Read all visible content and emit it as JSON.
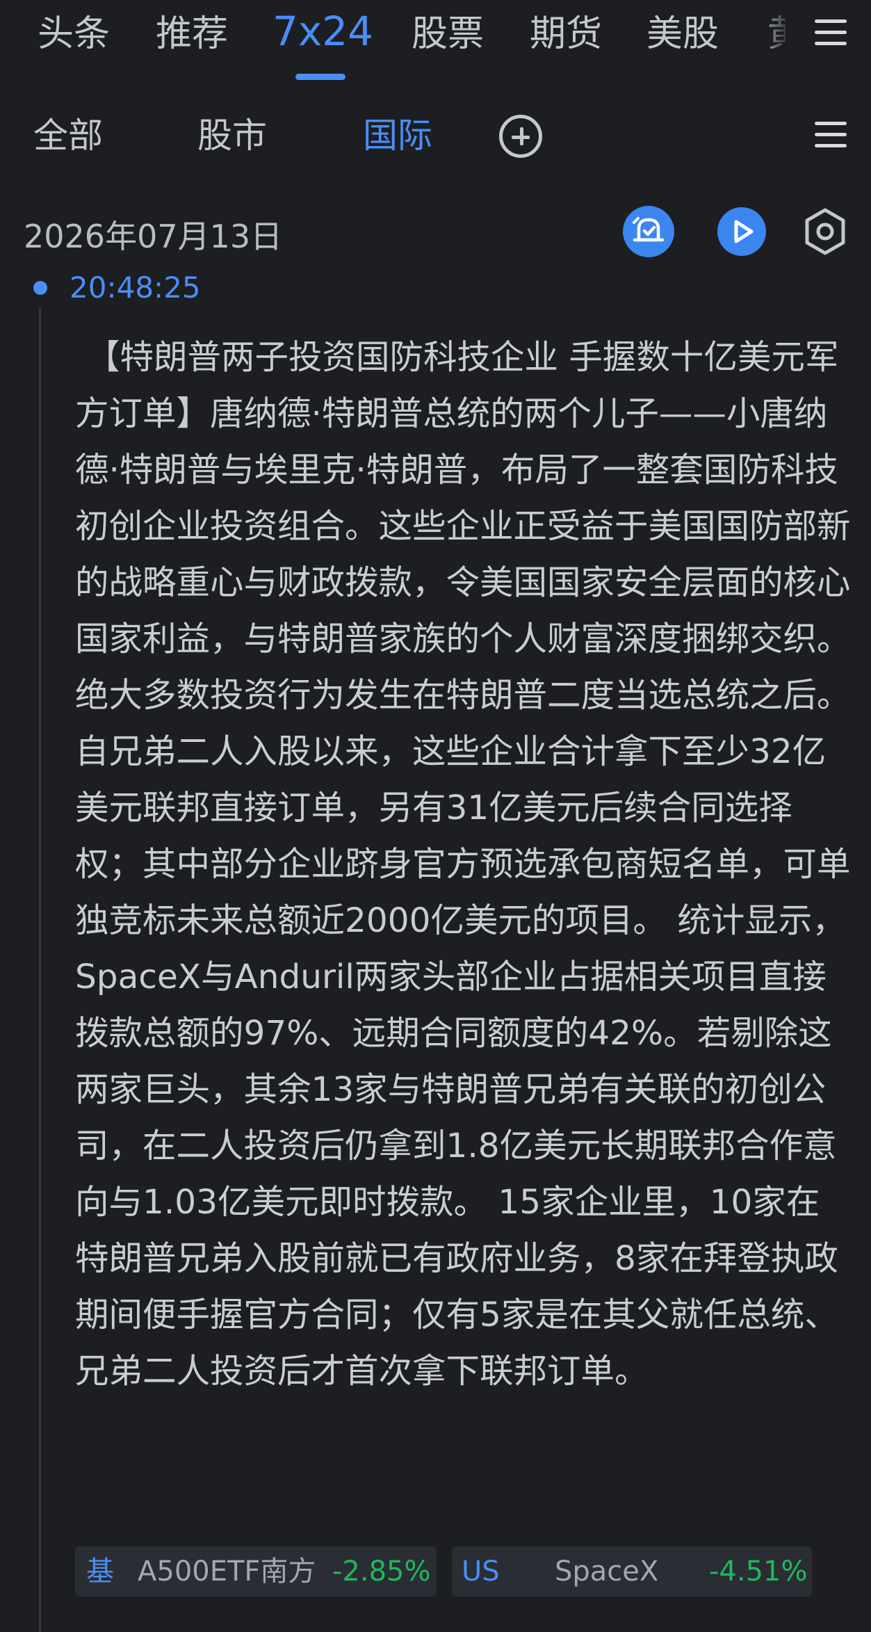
{
  "top_tabs": [
    {
      "label": "头条"
    },
    {
      "label": "推荐"
    },
    {
      "label": "7x24"
    },
    {
      "label": "股票"
    },
    {
      "label": "期货"
    },
    {
      "label": "美股"
    }
  ],
  "top_tab_cut": "黄",
  "sub_tabs": [
    {
      "label": "全部"
    },
    {
      "label": "股市"
    },
    {
      "label": "国际"
    }
  ],
  "date": "2026年07月13日",
  "item": {
    "time": "20:48:25",
    "content": "【特朗普两子投资国防科技企业 手握数十亿美元军方订单】唐纳德·特朗普总统的两个儿子——小唐纳德·特朗普与埃里克·特朗普，布局了一整套国防科技初创企业投资组合。这些企业正受益于美国国防部新的战略重心与财政拨款，令美国国家安全层面的核心国家利益，与特朗普家族的个人财富深度捆绑交织。绝大多数投资行为发生在特朗普二度当选总统之后。自兄弟二人入股以来，这些企业合计拿下至少32亿美元联邦直接订单，另有31亿美元后续合同选择权；其中部分企业跻身官方预选承包商短名单，可单独竞标未来总额近2000亿美元的项目。 统计显示，SpaceX与Anduril两家头部企业占据相关项目直接拨款总额的97%、远期合同额度的42%。若剔除这两家巨头，其余13家与特朗普兄弟有关联的初创公司，在二人投资后仍拿到1.8亿美元长期联邦合作意向与1.03亿美元即时拨款。 15家企业里，10家在特朗普兄弟入股前就已有政府业务，8家在拜登执政期间便手握官方合同；仅有5家是在其父就任总统、兄弟二人投资后才首次拿下联邦订单。",
    "stocks": [
      {
        "tag": "基",
        "name": "A500ETF南方",
        "change": "-2.85%"
      },
      {
        "tag": "US",
        "name": "SpaceX",
        "change": "-4.51%"
      }
    ]
  },
  "colors": {
    "background": "#1c1e21",
    "accent": "#4a8ef5",
    "text": "#c9cdd3",
    "down": "#1fb85b",
    "chip": "#2a2d33"
  }
}
